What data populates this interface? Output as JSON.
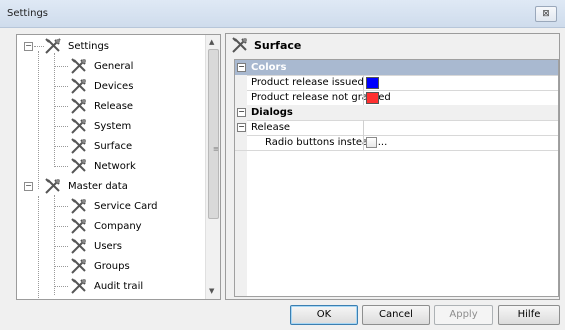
{
  "window": {
    "title": "Settings",
    "close_glyph": "⊠"
  },
  "tree": {
    "items": [
      {
        "label": "Settings",
        "level": 0,
        "expanded": true
      },
      {
        "label": "General",
        "level": 1
      },
      {
        "label": "Devices",
        "level": 1
      },
      {
        "label": "Release",
        "level": 1
      },
      {
        "label": "System",
        "level": 1
      },
      {
        "label": "Surface",
        "level": 1,
        "selected": true
      },
      {
        "label": "Network",
        "level": 1
      },
      {
        "label": "Master data",
        "level": 0,
        "expanded": true
      },
      {
        "label": "Service Card",
        "level": 1
      },
      {
        "label": "Company",
        "level": 1
      },
      {
        "label": "Users",
        "level": 1
      },
      {
        "label": "Groups",
        "level": 1
      },
      {
        "label": "Audit trail",
        "level": 1
      }
    ],
    "icon": "tools-icon"
  },
  "panel": {
    "heading": "Surface",
    "categories": {
      "colors": "Colors",
      "dialogs": "Dialogs",
      "release": "Release"
    },
    "properties": {
      "product_release_issued": {
        "label": "Product release issued",
        "color": "#0000ff"
      },
      "product_release_not_granted": {
        "label": "Product release not granted",
        "color": "#ff3030"
      },
      "radio_buttons": {
        "label": "Radio buttons instead ...",
        "checked": false
      }
    }
  },
  "buttons": {
    "ok": "OK",
    "cancel": "Cancel",
    "apply": "Apply",
    "help": "Hilfe"
  }
}
